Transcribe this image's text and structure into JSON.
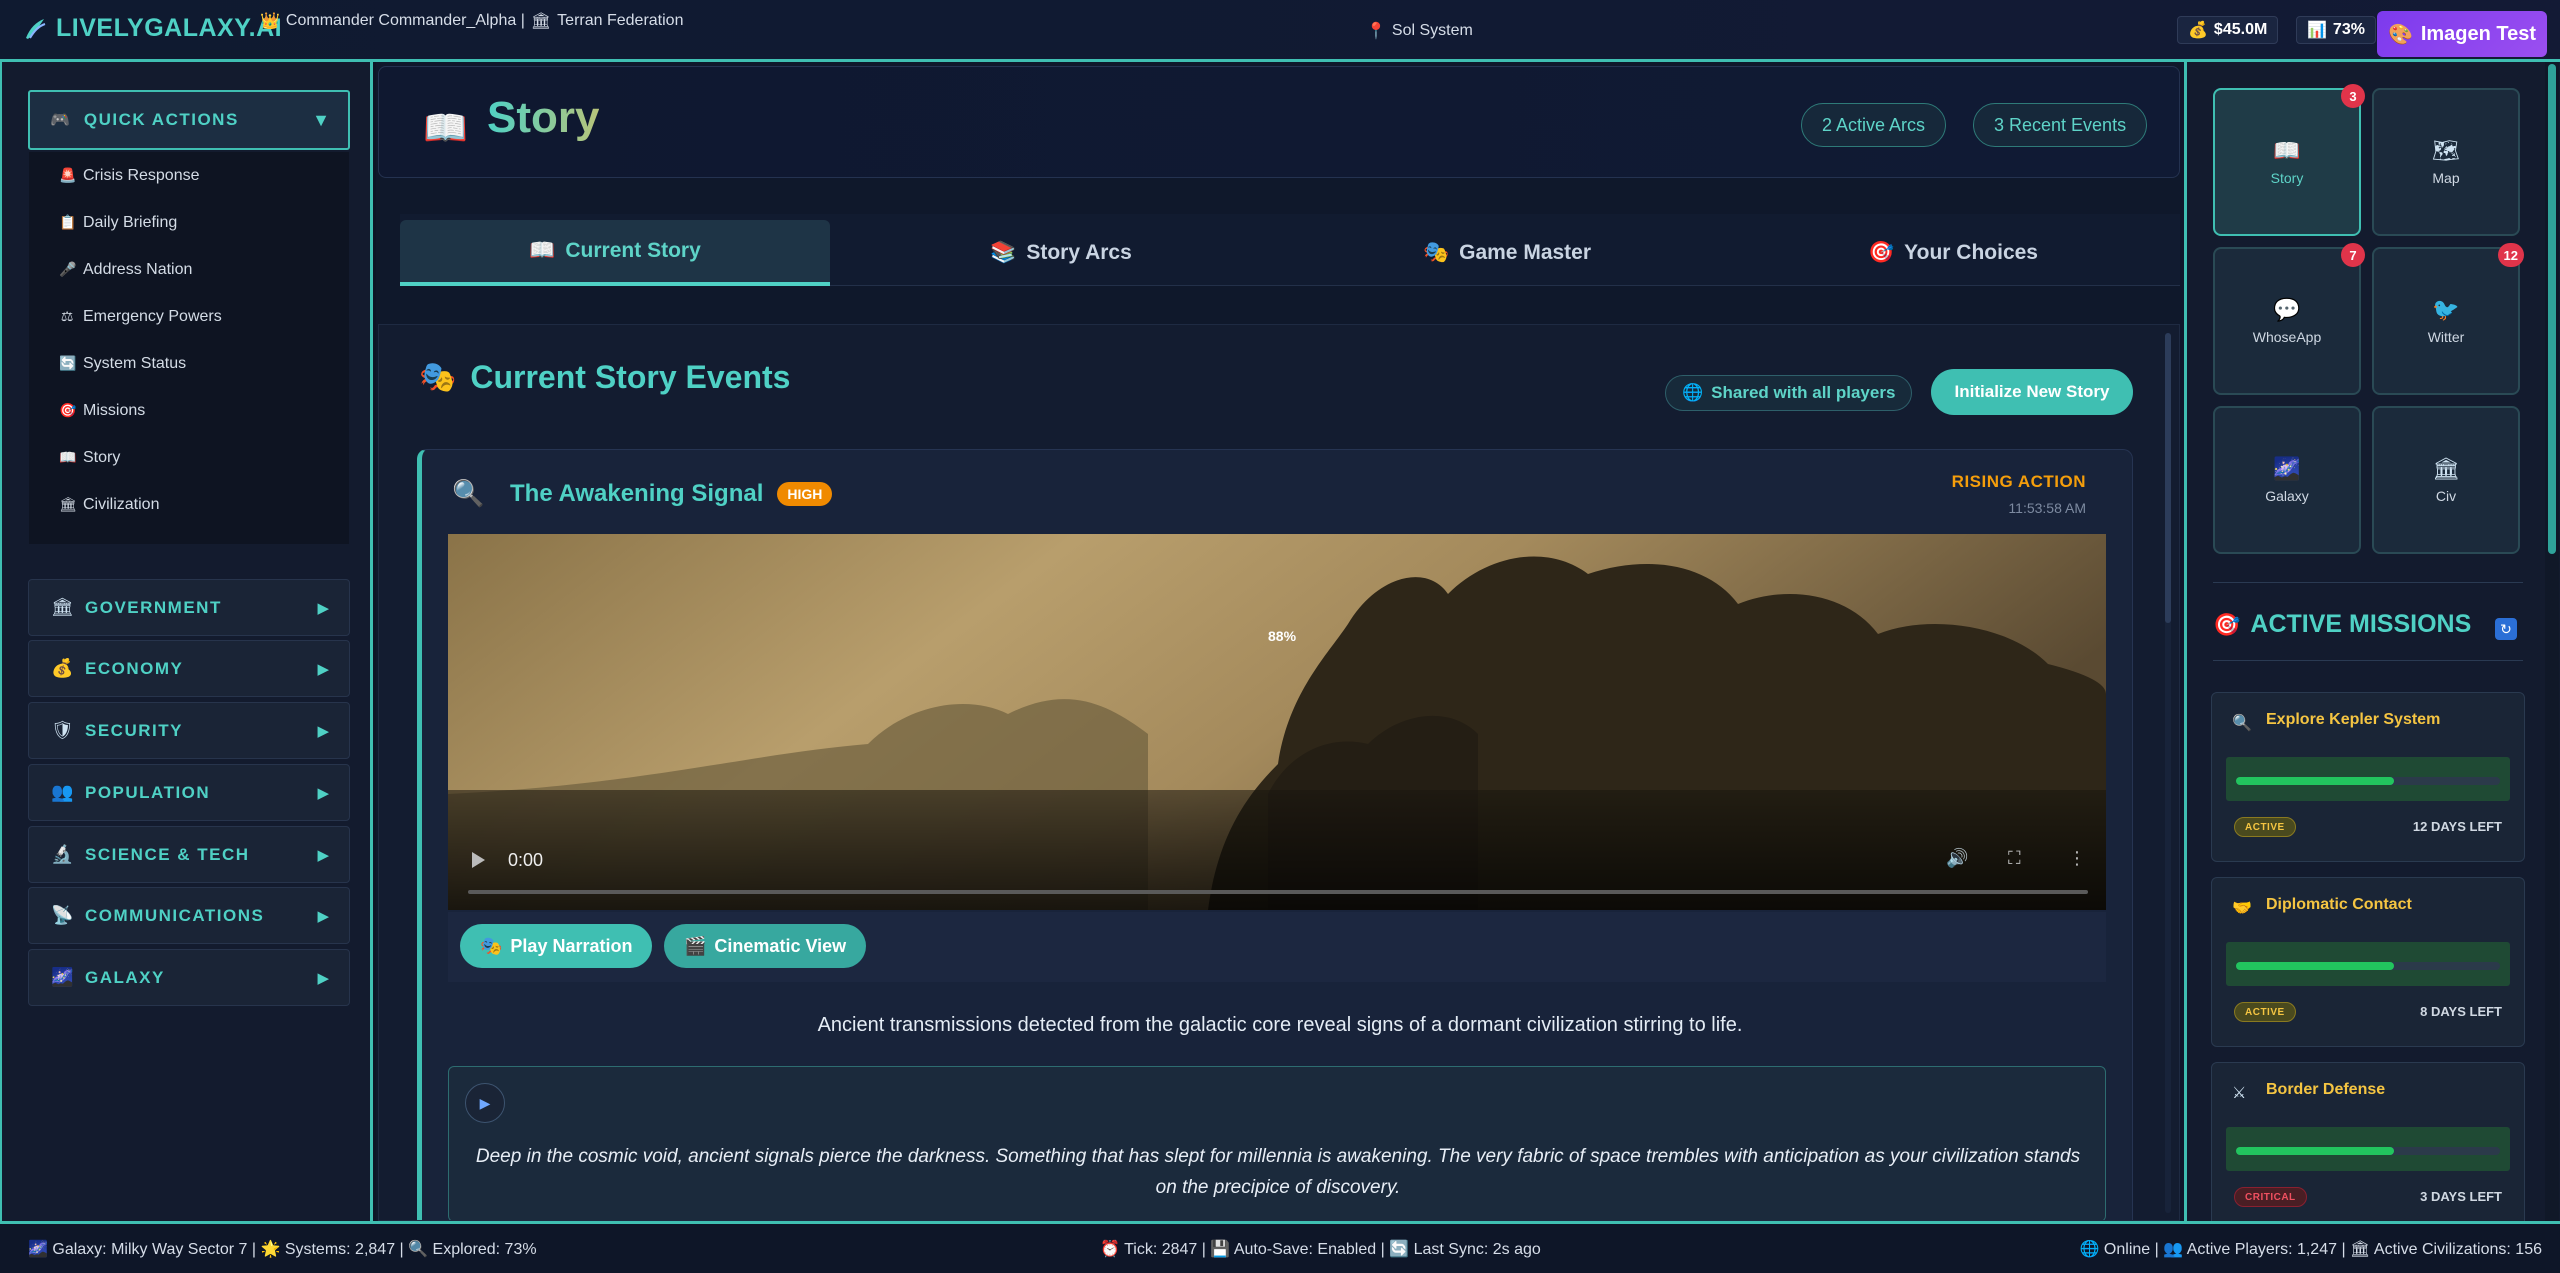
{
  "header": {
    "brand": "LIVELYGALAXY.AI",
    "commander": "Commander Commander_Alpha | ",
    "federation": "Terran Federation",
    "location": "Sol System",
    "money": "$45.0M",
    "approval": "73%",
    "imagen_button": "Imagen Test"
  },
  "sidebar": {
    "quick_actions_label": "QUICK ACTIONS",
    "quick_actions": [
      {
        "label": "Crisis Response",
        "icon": "siren-icon"
      },
      {
        "label": "Daily Briefing",
        "icon": "clipboard-icon"
      },
      {
        "label": "Address Nation",
        "icon": "microphone-icon"
      },
      {
        "label": "Emergency Powers",
        "icon": "scales-icon"
      },
      {
        "label": "System Status",
        "icon": "refresh-icon"
      },
      {
        "label": "Missions",
        "icon": "target-icon"
      },
      {
        "label": "Story",
        "icon": "book-icon"
      },
      {
        "label": "Civilization",
        "icon": "building-icon"
      }
    ],
    "categories": [
      {
        "label": "GOVERNMENT",
        "icon": "building-icon"
      },
      {
        "label": "ECONOMY",
        "icon": "money-bag-icon"
      },
      {
        "label": "SECURITY",
        "icon": "shield-icon"
      },
      {
        "label": "POPULATION",
        "icon": "people-icon"
      },
      {
        "label": "SCIENCE & TECH",
        "icon": "microscope-icon"
      },
      {
        "label": "COMMUNICATIONS",
        "icon": "satellite-icon"
      },
      {
        "label": "GALAXY",
        "icon": "galaxy-icon"
      }
    ]
  },
  "story": {
    "title": "Story",
    "active_arcs": "2 Active Arcs",
    "recent_events": "3 Recent Events",
    "tabs": [
      {
        "label": "Current Story",
        "icon": "book-icon"
      },
      {
        "label": "Story Arcs",
        "icon": "books-icon"
      },
      {
        "label": "Game Master",
        "icon": "masks-icon"
      },
      {
        "label": "Your Choices",
        "icon": "target-icon"
      }
    ],
    "section_title": "Current Story Events",
    "shared_label": "Shared with all players",
    "init_button": "Initialize New Story",
    "event": {
      "title": "The Awakening Signal",
      "priority": "HIGH",
      "phase": "RISING ACTION",
      "time": "11:53:58 AM",
      "video_loading": "88%",
      "video_time": "0:00",
      "play_narration": "Play Narration",
      "cinematic_view": "Cinematic View",
      "summary": "Ancient transmissions detected from the galactic core reveal signs of a dormant civilization stirring to life.",
      "narrative": "Deep in the cosmic void, ancient signals pierce the darkness. Something that has slept for millennia is awakening. The very fabric of space trembles with anticipation as your civilization stands on the precipice of discovery."
    }
  },
  "right_panel": {
    "tiles": [
      {
        "label": "Story",
        "icon": "book-icon",
        "count": "3"
      },
      {
        "label": "Map",
        "icon": "map-icon",
        "count": ""
      },
      {
        "label": "WhoseApp",
        "icon": "chat-bubble-icon",
        "count": "7"
      },
      {
        "label": "Witter",
        "icon": "bird-icon",
        "count": "12"
      },
      {
        "label": "Galaxy",
        "icon": "galaxy-icon",
        "count": ""
      },
      {
        "label": "Civ",
        "icon": "building-icon",
        "count": ""
      }
    ],
    "missions_title": "ACTIVE MISSIONS",
    "missions": [
      {
        "name": "Explore Kepler System",
        "status": "ACTIVE",
        "days": "12 DAYS LEFT",
        "progress": 0.6
      },
      {
        "name": "Diplomatic Contact",
        "status": "ACTIVE",
        "days": "8 DAYS LEFT",
        "progress": 0.6
      },
      {
        "name": "Border Defense",
        "status": "CRITICAL",
        "days": "3 DAYS LEFT",
        "progress": 0.6
      }
    ]
  },
  "footer": {
    "galaxy": "Galaxy: Milky Way Sector 7 | ",
    "systems": "Systems: 2,847 | ",
    "explored": "Explored: 73%",
    "tick": "Tick: 2847 | ",
    "autosave": "Auto-Save: Enabled | ",
    "sync": "Last Sync: 2s ago",
    "online": "Online | ",
    "players": "Active Players: 1,247 | ",
    "civs": "Active Civilizations: 156"
  },
  "colors": {
    "accent": "#4fd1c5",
    "border": "#3fbfb2",
    "priority_high": "#f08a00",
    "phase": "#f59e0b",
    "mission_name": "#f5c542",
    "badge_red": "#e0344a",
    "imagen_purple": "#7c3aed"
  }
}
